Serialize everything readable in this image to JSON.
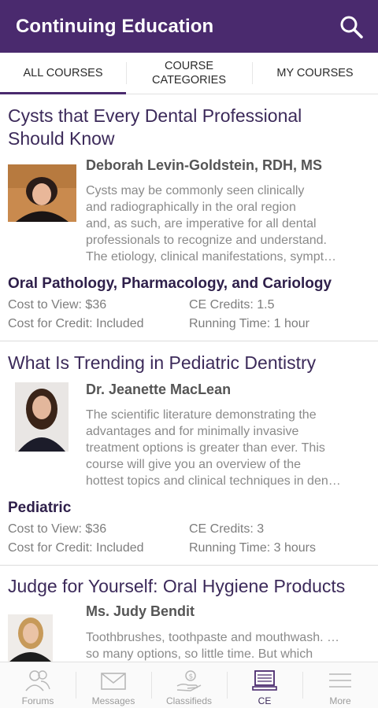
{
  "appbar": {
    "title": "Continuing Education",
    "search_icon": "search-icon"
  },
  "tabs": [
    {
      "label": "ALL COURSES",
      "active": true
    },
    {
      "label": "COURSE\nCATEGORIES",
      "active": false
    },
    {
      "label": "MY COURSES",
      "active": false
    }
  ],
  "courses": [
    {
      "title_line1": "Cysts that Every Dental Professional",
      "title_line2": "Should Know",
      "instructor": "Deborah Levin-Goldstein, RDH, MS",
      "description": [
        "Cysts may be commonly seen clinically",
        "and radiographically in the oral region",
        "and, as such, are imperative for all dental",
        "professionals to recognize and understand.",
        "The etiology, clinical manifestations, sympt…"
      ],
      "category": "Oral Pathology, Pharmacology, and Cariology",
      "cost_view": "Cost to View: $36",
      "ce_credits": "CE Credits: 1.5",
      "cost_credit": "Cost for Credit: Included",
      "running_time": "Running Time: 1 hour"
    },
    {
      "title_line1": "What Is Trending in Pediatric Dentistry",
      "instructor": "Dr. Jeanette MacLean",
      "description": [
        "The scientific literature demonstrating the",
        "advantages and for minimally invasive",
        "treatment options is greater than ever. This",
        "course will give you an overview of the",
        "hottest topics and clinical techniques in den…"
      ],
      "category": "Pediatric",
      "cost_view": "Cost to View: $36",
      "ce_credits": "CE Credits: 3",
      "cost_credit": "Cost for Credit: Included",
      "running_time": "Running Time: 3 hours"
    },
    {
      "title_line1": "Judge for Yourself: Oral Hygiene Products",
      "instructor": "Ms. Judy Bendit",
      "description": [
        "Toothbrushes, toothpaste and mouthwash. …",
        "so many options, so little time. But which"
      ]
    }
  ],
  "bottom_nav": [
    {
      "label": "Forums",
      "icon": "users-icon",
      "active": false
    },
    {
      "label": "Messages",
      "icon": "envelope-icon",
      "active": false
    },
    {
      "label": "Classifieds",
      "icon": "hand-money-icon",
      "active": false
    },
    {
      "label": "CE",
      "icon": "monitor-icon",
      "active": true
    },
    {
      "label": "More",
      "icon": "menu-icon",
      "active": false
    }
  ],
  "colors": {
    "brand": "#4a2a6e",
    "title_text": "#3c2a5a",
    "category_text": "#2e1f4a"
  }
}
